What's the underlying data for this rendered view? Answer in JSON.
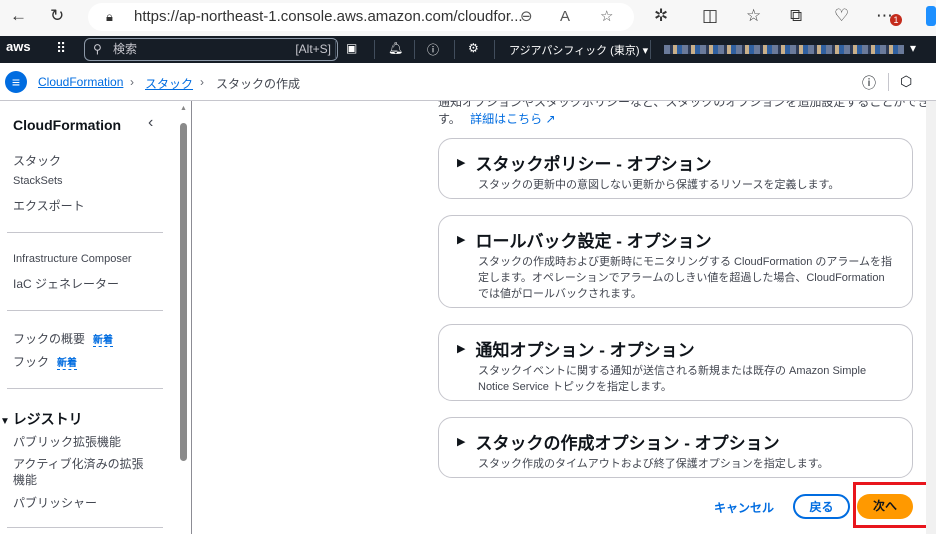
{
  "browser": {
    "url": "https://ap-northeast-1.console.aws.amazon.com/cloudfor...",
    "badge": "1"
  },
  "awsnav": {
    "logo": "aws",
    "search_placeholder": "検索",
    "search_shortcut": "[Alt+S]",
    "region": "アジアパシフィック (東京)"
  },
  "breadcrumb": {
    "items": [
      "CloudFormation",
      "スタック",
      "スタックの作成"
    ]
  },
  "sidebar": {
    "title": "CloudFormation",
    "group1": [
      "スタック",
      "StackSets",
      "エクスポート"
    ],
    "group2": [
      "Infrastructure Composer",
      "IaC ジェネレーター"
    ],
    "group3": [
      {
        "label": "フックの概要",
        "badge": "新着"
      },
      {
        "label": "フック",
        "badge": "新着"
      }
    ],
    "registry": {
      "title": "レジストリ",
      "items": [
        "パブリック拡張機能",
        "アクティブ化済みの拡張機能",
        "パブリッシャー"
      ]
    }
  },
  "main": {
    "intro": "通知オプションやスタックポリシーなど、スタックのオプションを追加設定することができます。",
    "intro_end": "す。",
    "learn_more": "詳細はこちら",
    "sections": [
      {
        "title": "スタックポリシー - オプション",
        "desc": "スタックの更新中の意図しない更新から保護するリソースを定義します。"
      },
      {
        "title": "ロールバック設定 - オプション",
        "desc": "スタックの作成時および更新時にモニタリングする CloudFormation のアラームを指定します。オペレーションでアラームのしきい値を超過した場合、CloudFormation では値がロールバックされます。"
      },
      {
        "title": "通知オプション - オプション",
        "desc": "スタックイベントに関する通知が送信される新規または既存の Amazon Simple Notice Service トピックを指定します。"
      },
      {
        "title": "スタックの作成オプション - オプション",
        "desc": "スタック作成のタイムアウトおよび終了保護オプションを指定します。"
      }
    ],
    "cancel": "キャンセル",
    "back": "戻る",
    "next": "次へ"
  },
  "colors": {
    "primary": "#ff9900",
    "link": "#006ce0",
    "highlight": "#e8151d"
  }
}
